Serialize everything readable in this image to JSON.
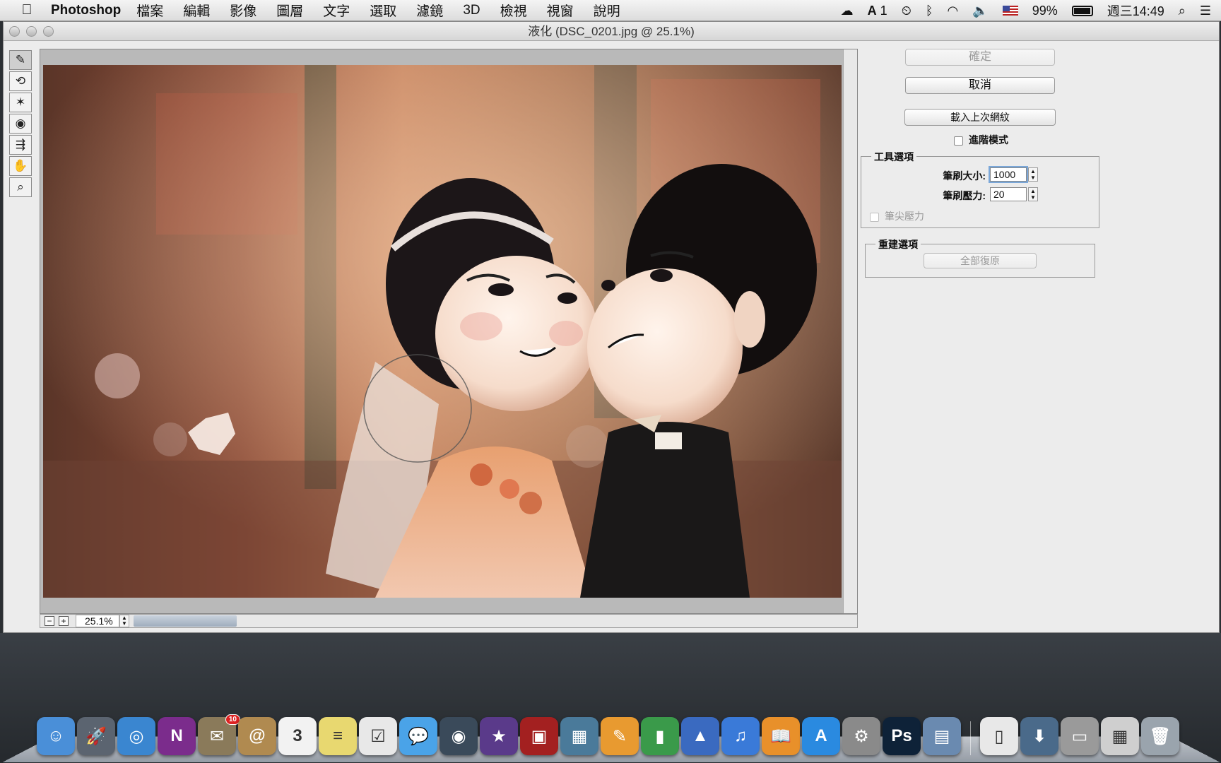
{
  "menubar": {
    "app_name": "Photoshop",
    "items": [
      "檔案",
      "編輯",
      "影像",
      "圖層",
      "文字",
      "選取",
      "濾鏡",
      "3D",
      "檢視",
      "視窗",
      "說明"
    ],
    "status": {
      "adobe_count": "1",
      "battery": "99%",
      "clock": "週三14:49"
    }
  },
  "window": {
    "title": "液化 (DSC_0201.jpg @ 25.1%)"
  },
  "tools": [
    {
      "name": "forward-warp-tool",
      "glyph": "✎"
    },
    {
      "name": "reconstruct-tool",
      "glyph": "⟲"
    },
    {
      "name": "pucker-tool",
      "glyph": "✶"
    },
    {
      "name": "bloat-tool",
      "glyph": "◉"
    },
    {
      "name": "push-left-tool",
      "glyph": "⇶"
    },
    {
      "name": "hand-tool",
      "glyph": "✋"
    },
    {
      "name": "zoom-tool",
      "glyph": "⌕"
    }
  ],
  "zoom": {
    "minus": "−",
    "plus": "+",
    "value": "25.1%"
  },
  "panel": {
    "ok": "確定",
    "cancel": "取消",
    "load_mesh": "載入上次網紋",
    "advanced_mode": "進階模式",
    "tool_options": {
      "legend": "工具選項",
      "brush_size_label": "筆刷大小:",
      "brush_size_value": "1000",
      "brush_pressure_label": "筆刷壓力:",
      "brush_pressure_value": "20",
      "stylus_pressure": "筆尖壓力"
    },
    "reconstruct": {
      "legend": "重建選項",
      "restore_all": "全部復原"
    }
  },
  "dock": [
    {
      "name": "finder-icon",
      "color": "#4a8fd8",
      "glyph": "☺"
    },
    {
      "name": "launchpad-icon",
      "color": "#5b6470",
      "glyph": "🚀"
    },
    {
      "name": "safari-icon",
      "color": "#3a86d0",
      "glyph": "◎"
    },
    {
      "name": "onenote-icon",
      "color": "#7b2c8c",
      "glyph": "N"
    },
    {
      "name": "mail-app-icon",
      "color": "#8a7a5a",
      "glyph": "✉",
      "badge": "10"
    },
    {
      "name": "contacts-icon",
      "color": "#b08a50",
      "glyph": "@"
    },
    {
      "name": "calendar-icon",
      "color": "#f2f2f2",
      "glyph": "3"
    },
    {
      "name": "notes-icon",
      "color": "#e8d870",
      "glyph": "≡"
    },
    {
      "name": "reminders-icon",
      "color": "#e8e8e8",
      "glyph": "☑"
    },
    {
      "name": "messages-icon",
      "color": "#4aa3e8",
      "glyph": "💬"
    },
    {
      "name": "facetime-icon",
      "color": "#3a4a5a",
      "glyph": "◉"
    },
    {
      "name": "imovie-icon",
      "color": "#5a3a8a",
      "glyph": "★"
    },
    {
      "name": "photo-booth-icon",
      "color": "#a32020",
      "glyph": "▣"
    },
    {
      "name": "iphoto-icon",
      "color": "#4a7a9a",
      "glyph": "▦"
    },
    {
      "name": "pages-icon",
      "color": "#e89a30",
      "glyph": "✎"
    },
    {
      "name": "numbers-icon",
      "color": "#3a9a4a",
      "glyph": "▮"
    },
    {
      "name": "keynote-icon",
      "color": "#3a6ac0",
      "glyph": "▲"
    },
    {
      "name": "itunes-icon",
      "color": "#3a7ad8",
      "glyph": "♫"
    },
    {
      "name": "ibooks-icon",
      "color": "#e8902a",
      "glyph": "📖"
    },
    {
      "name": "app-store-icon",
      "color": "#2a8ae0",
      "glyph": "A"
    },
    {
      "name": "system-preferences-icon",
      "color": "#8a8a8a",
      "glyph": "⚙"
    },
    {
      "name": "photoshop-icon",
      "color": "#0e2238",
      "glyph": "Ps"
    },
    {
      "name": "preview-icon",
      "color": "#6a8ab0",
      "glyph": "▤"
    },
    {
      "name": "documents-stack-icon",
      "color": "#e8e8e8",
      "glyph": "▯"
    },
    {
      "name": "downloads-stack-icon",
      "color": "#4a6a8a",
      "glyph": "⬇"
    },
    {
      "name": "desktop-stack-icon",
      "color": "#9a9a9a",
      "glyph": "▭"
    },
    {
      "name": "applications-stack-icon",
      "color": "#cfcfcf",
      "glyph": "▦"
    },
    {
      "name": "trash-icon",
      "color": "#9aa4ad",
      "glyph": "🗑"
    }
  ]
}
